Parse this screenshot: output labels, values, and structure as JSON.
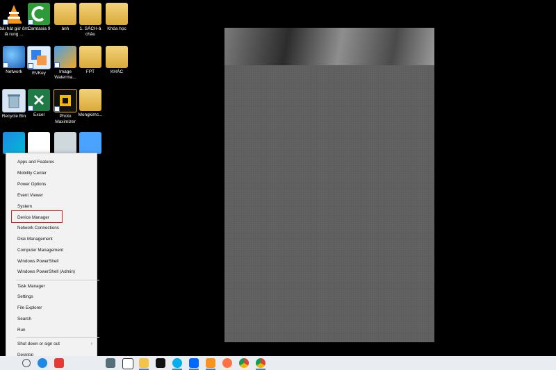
{
  "desktop_icons": [
    {
      "label": "bài hát giờ ôm lả rung ...",
      "icon": "vlc-icon"
    },
    {
      "label": "Camtasia 9",
      "icon": "camtasia-icon"
    },
    {
      "label": "ảnh",
      "icon": "folder-icon"
    },
    {
      "label": "1. SÁCH-ả châu",
      "icon": "folder-icon"
    },
    {
      "label": "Khóa học",
      "icon": "folder-icon"
    },
    {
      "label": "Network",
      "icon": "network-icon"
    },
    {
      "label": "EVKey",
      "icon": "evkey-icon"
    },
    {
      "label": "Image Waterma...",
      "icon": "image-watermark-icon"
    },
    {
      "label": "FPT",
      "icon": "folder-icon"
    },
    {
      "label": "KHÁC",
      "icon": "folder-icon"
    },
    {
      "label": "Recycle Bin",
      "icon": "recycle-bin-icon"
    },
    {
      "label": "Excel",
      "icon": "excel-icon"
    },
    {
      "label": "Photo Maximizer",
      "icon": "photo-maximizer-icon"
    },
    {
      "label": "Mongkimc...",
      "icon": "folder-icon"
    }
  ],
  "context_menu": {
    "items": [
      "Apps and Features",
      "Mobility Center",
      "Power Options",
      "Event Viewer",
      "System",
      "Device Manager",
      "Network Connections",
      "Disk Management",
      "Computer Management",
      "Windows PowerShell",
      "Windows PowerShell (Admin)",
      "Task Manager",
      "Settings",
      "File Explorer",
      "Search",
      "Run",
      "Shut down or sign out",
      "Desktop"
    ],
    "highlighted": "Device Manager",
    "submenu_arrow": "›"
  },
  "colors": {
    "highlight_border": "#e0201a",
    "taskbar": "#e9edf2",
    "menu_bg": "#f2f2f2"
  },
  "taskbar_icons": [
    "calculator-icon",
    "checkbox-app-icon",
    "file-explorer-icon",
    "capcut-icon",
    "skype-icon",
    "zalo-icon",
    "photo-app-icon",
    "media-icon",
    "chrome-icon",
    "chrome-icon"
  ]
}
